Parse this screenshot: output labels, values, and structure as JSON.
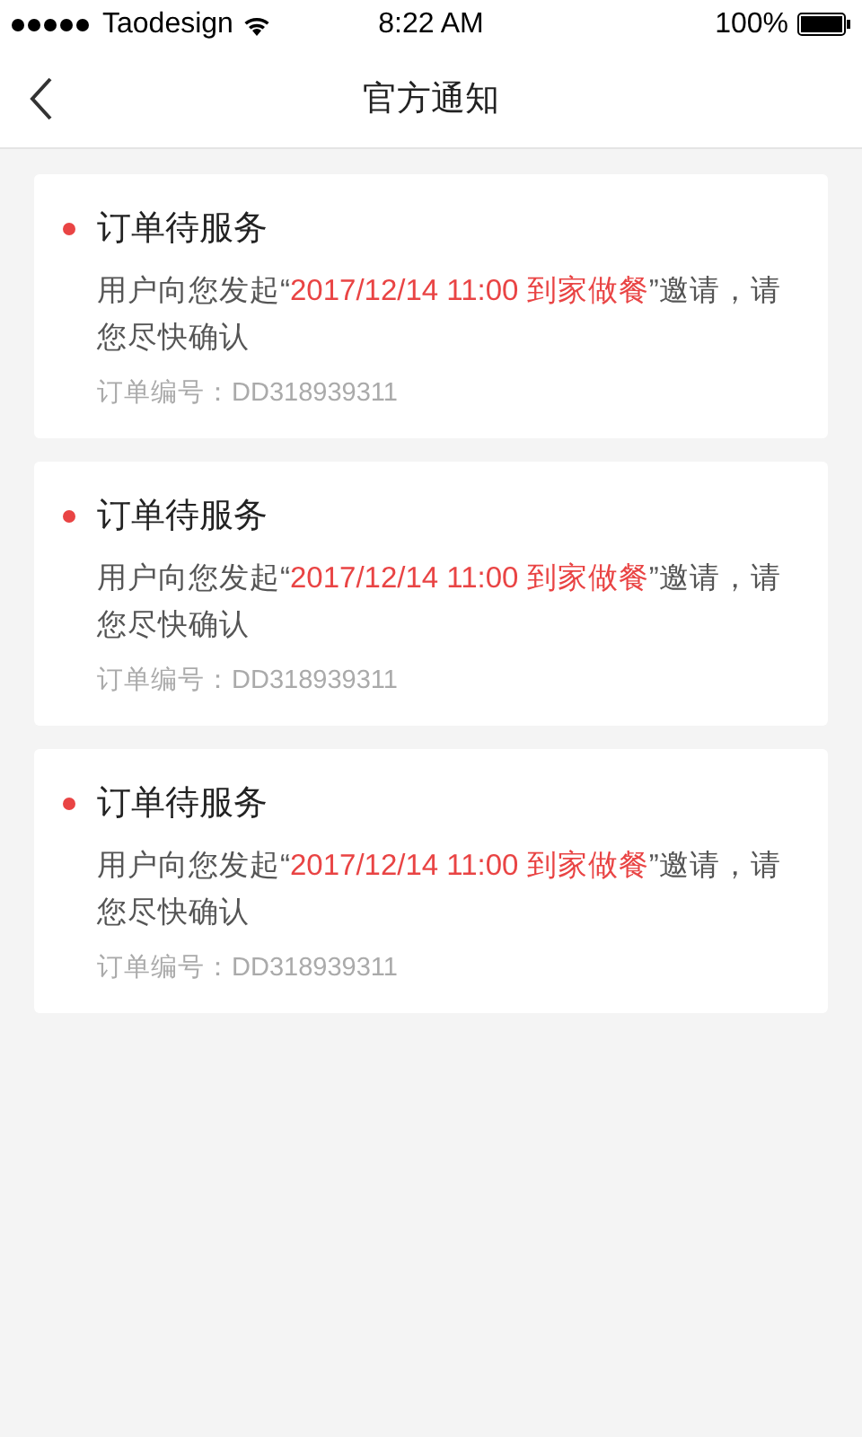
{
  "status_bar": {
    "carrier": "Taodesign",
    "time": "8:22 AM",
    "battery": "100%"
  },
  "nav": {
    "title": "官方通知"
  },
  "notifications": [
    {
      "unread": true,
      "title": "订单待服务",
      "message_before": "用户向您发起“",
      "highlight": "2017/12/14 11:00 到家做餐",
      "message_after": "”邀请，请您尽快确认",
      "order": "订单编号：DD318939311"
    },
    {
      "unread": true,
      "title": "订单待服务",
      "message_before": "用户向您发起“",
      "highlight": "2017/12/14 11:00 到家做餐",
      "message_after": "”邀请，请您尽快确认",
      "order": "订单编号：DD318939311"
    },
    {
      "unread": true,
      "title": "订单待服务",
      "message_before": "用户向您发起“",
      "highlight": "2017/12/14 11:00 到家做餐",
      "message_after": "”邀请，请您尽快确认",
      "order": "订单编号：DD318939311"
    }
  ]
}
